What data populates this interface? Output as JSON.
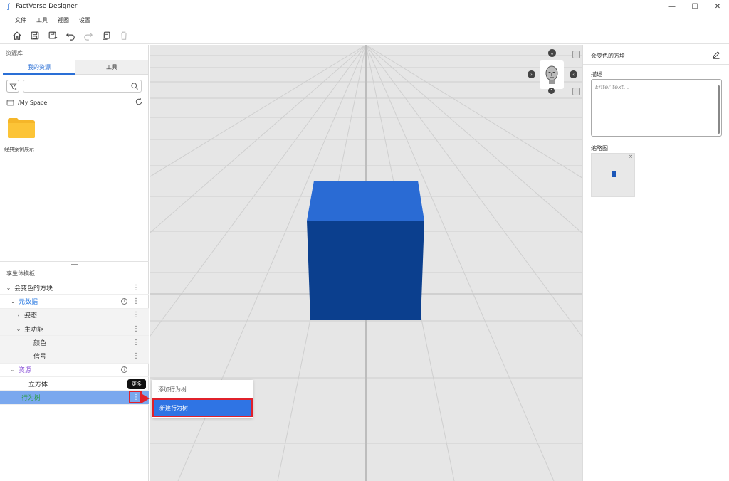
{
  "window": {
    "title": "FactVerse Designer",
    "controls": {
      "minimize": "—",
      "maximize": "☐",
      "close": "✕"
    }
  },
  "menu": [
    "文件",
    "工具",
    "视图",
    "设置"
  ],
  "toolbar": {
    "icons": [
      "home-icon",
      "save-icon",
      "save-as-icon",
      "undo-icon",
      "redo-icon",
      "copy-icon",
      "delete-icon"
    ]
  },
  "left": {
    "library_label": "资源库",
    "tabs": [
      {
        "label": "我的资源"
      },
      {
        "label": "工具"
      }
    ],
    "search": {
      "value": "",
      "placeholder": ""
    },
    "path": "/My Space",
    "folder": {
      "label": "经典案例展示"
    },
    "template_label": "孪生体模板",
    "tree": [
      {
        "label": "会变色的方块",
        "chev": "⌄"
      },
      {
        "label": "元数据",
        "chev": "⌄"
      },
      {
        "label": "姿态",
        "chev": "›"
      },
      {
        "label": "主功能",
        "chev": "⌄"
      },
      {
        "label": "颜色"
      },
      {
        "label": "信号"
      },
      {
        "label": "资源",
        "chev": "⌄"
      },
      {
        "label": "立方体"
      },
      {
        "label": "行为树"
      }
    ],
    "more_glyph": "⋮",
    "info_glyph": "i",
    "tooltip": "更多"
  },
  "context_menu": {
    "items": [
      {
        "label": "添加行为树"
      },
      {
        "label": "新建行为树"
      }
    ]
  },
  "right": {
    "title": "会变色的方块",
    "desc_label": "描述",
    "desc_placeholder": "Enter text...",
    "thumb_label": "缩略图",
    "thumb_close": "×"
  },
  "colors": {
    "accent": "#2a6fd6",
    "cube_top": "#2a6bd4",
    "cube_front": "#0b3f8e",
    "highlight": "#e0212b",
    "selected_row": "#7aa8ee"
  }
}
